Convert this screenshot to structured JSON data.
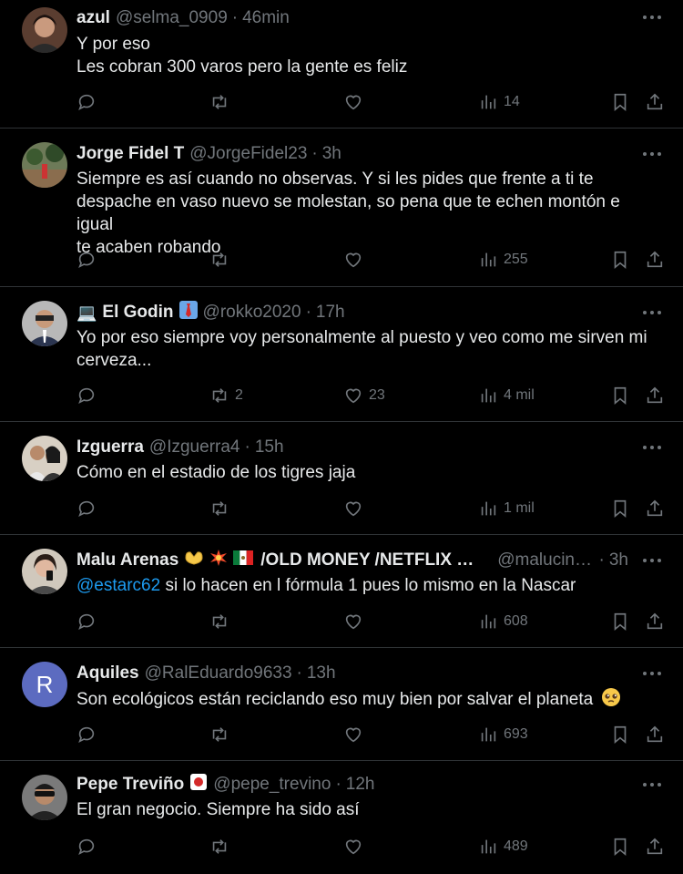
{
  "tweets": [
    {
      "name": "azul",
      "name_emojis": [],
      "handle": "@selma_0909",
      "time": "46min",
      "body": [
        "Y por eso",
        "Les cobran 300 varos pero la gente es feliz"
      ],
      "replies": "",
      "retweets": "",
      "likes": "",
      "views": "14",
      "avatar_color": "#6b4a3a",
      "avatar_type": "photo"
    },
    {
      "name": "Jorge Fidel T",
      "name_emojis": [],
      "handle": "@JorgeFidel23",
      "time": "3h",
      "body": [
        "Siempre es así cuando no observas. Y si les pides que frente a ti te",
        "despache en vaso nuevo se molestan, so pena que te echen montón e igual",
        "te acaben robando"
      ],
      "replies": "",
      "retweets": "",
      "likes": "",
      "views": "255",
      "avatar_color": "#3f5a3a",
      "avatar_type": "photo"
    },
    {
      "name": "El Godin",
      "name_prefix_emoji": "laptop-emoji",
      "name_emojis": [
        "necktie-emoji"
      ],
      "handle": "@rokko2020",
      "time": "17h",
      "body": [
        "Yo por eso siempre voy personalmente al puesto y veo como me sirven mi",
        "cerveza..."
      ],
      "replies": "",
      "retweets": "2",
      "likes": "23",
      "views": "4 mil",
      "avatar_color": "#8a8a8a",
      "avatar_type": "photo"
    },
    {
      "name": "Izguerra",
      "name_emojis": [],
      "handle": "@Izguerra4",
      "time": "15h",
      "body": [
        "Cómo en el estadio de los tigres jaja"
      ],
      "replies": "",
      "retweets": "",
      "likes": "",
      "views": "1 mil",
      "avatar_color": "#9a8a7a",
      "avatar_type": "photo"
    },
    {
      "name": "Malu Arenas",
      "name_emojis": [
        "heart-hands-emoji",
        "collision-emoji",
        "mexico-flag-emoji"
      ],
      "name_suffix": "/OLD MONEY /NETFLIX PR...",
      "handle": "@malucine...",
      "time": "3h",
      "mention": "@estarc62",
      "body": [
        " si lo hacen en l fórmula 1 pues lo mismo en la Nascar"
      ],
      "replies": "",
      "retweets": "",
      "likes": "",
      "views": "608",
      "avatar_color": "#5a4a4a",
      "avatar_type": "photo"
    },
    {
      "name": "Aquiles",
      "name_emojis": [],
      "handle": "@RalEduardo9633",
      "time": "13h",
      "body": [
        "Son ecológicos  están reciclando eso muy bien por salvar el planeta"
      ],
      "body_emoji": "pleading-face-emoji",
      "replies": "",
      "retweets": "",
      "likes": "",
      "views": "693",
      "avatar_color": "#5c6bc0",
      "avatar_type": "letter",
      "avatar_letter": "R"
    },
    {
      "name": "Pepe Treviño",
      "name_emojis": [
        "ticket-emoji"
      ],
      "handle": "@pepe_trevino",
      "time": "12h",
      "body": [
        "El gran negocio. Siempre ha sido así"
      ],
      "replies": "",
      "retweets": "",
      "likes": "",
      "views": "489",
      "avatar_color": "#4a4a4a",
      "avatar_type": "photo"
    }
  ],
  "icons": {
    "reply": "reply-icon",
    "retweet": "retweet-icon",
    "like": "heart-icon",
    "views": "views-chart-icon",
    "bookmark": "bookmark-icon",
    "share": "share-icon",
    "more": "more-icon"
  },
  "colors": {
    "background": "#000000",
    "text": "#e7e9ea",
    "muted": "#71767b",
    "link": "#1d9bf0",
    "divider": "#2f3336"
  }
}
